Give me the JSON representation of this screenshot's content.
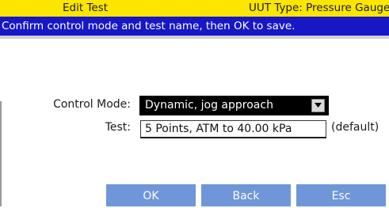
{
  "header": {
    "title": "Edit Test",
    "uut_type": "UUT Type:  Pressure Gauge"
  },
  "instruction": "Confirm control mode and test name, then OK to save.",
  "form": {
    "control_mode_label": "Control Mode:",
    "control_mode_value": "Dynamic, jog approach",
    "test_label": "Test:",
    "test_value": "5 Points, ATM to 40.00 kPa",
    "test_note": "(default)"
  },
  "buttons": {
    "ok": "OK",
    "back": "Back",
    "esc": "Esc"
  },
  "colors": {
    "title_bar": "#fce600",
    "instruction_bar": "#1717c6",
    "button": "#6f96d8",
    "select_bg": "#000000"
  },
  "icons": {
    "dropdown": "chevron-down-icon"
  }
}
